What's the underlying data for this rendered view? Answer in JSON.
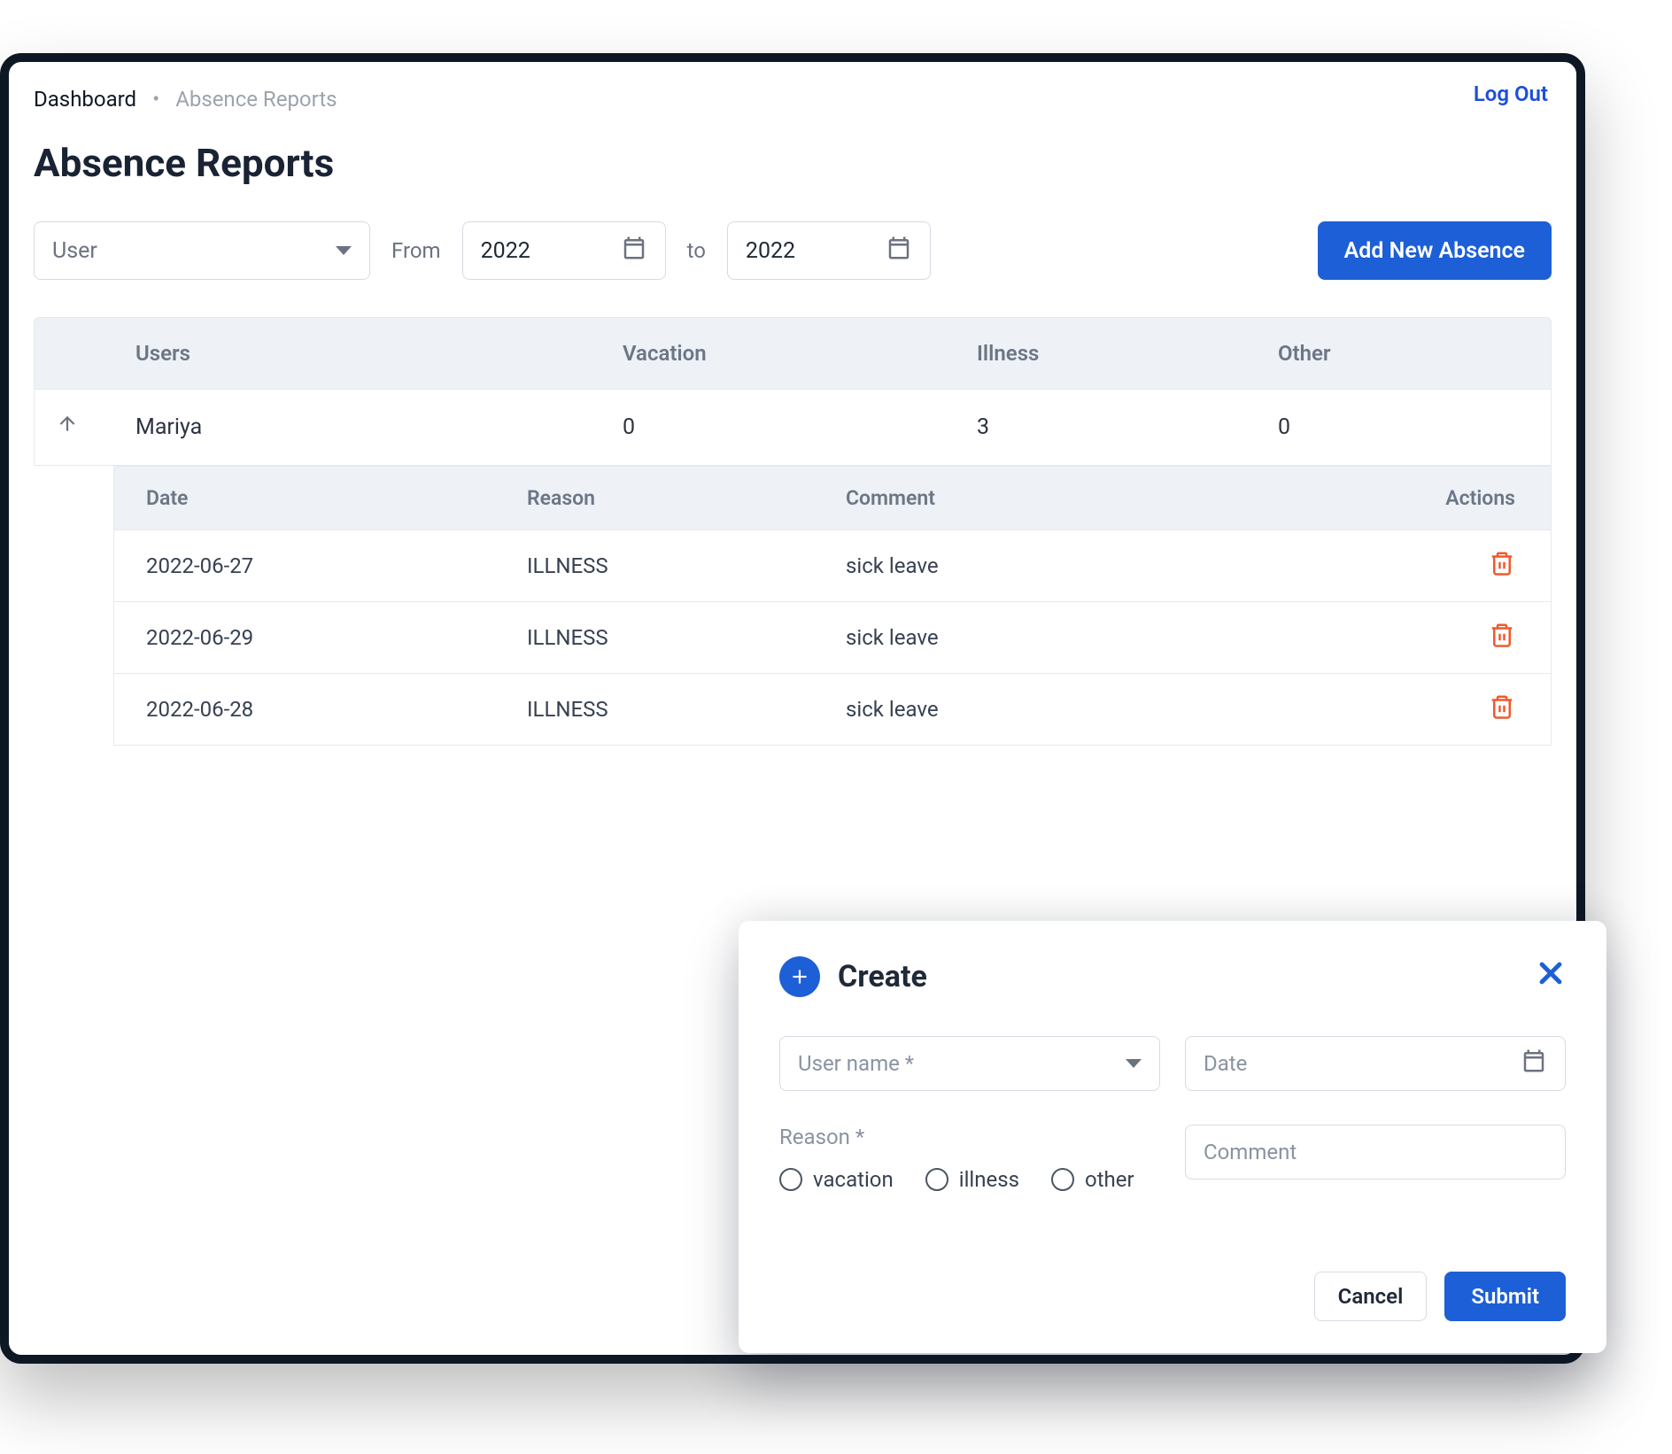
{
  "header": {
    "breadcrumb": [
      "Dashboard",
      "Absence Reports"
    ],
    "logout": "Log Out",
    "title": "Absence Reports"
  },
  "filters": {
    "user_placeholder": "User",
    "from_label": "From",
    "from_value": "2022",
    "to_label": "to",
    "to_value": "2022",
    "add_button": "Add New Absence"
  },
  "summary_table": {
    "columns": [
      "Users",
      "Vacation",
      "Illness",
      "Other"
    ],
    "rows": [
      {
        "user": "Mariya",
        "vacation": "0",
        "illness": "3",
        "other": "0"
      }
    ]
  },
  "detail_table": {
    "columns": [
      "Date",
      "Reason",
      "Comment",
      "Actions"
    ],
    "rows": [
      {
        "date": "2022-06-27",
        "reason": "ILLNESS",
        "comment": "sick leave"
      },
      {
        "date": "2022-06-29",
        "reason": "ILLNESS",
        "comment": "sick leave"
      },
      {
        "date": "2022-06-28",
        "reason": "ILLNESS",
        "comment": "sick leave"
      }
    ]
  },
  "modal": {
    "title": "Create",
    "user_placeholder": "User name *",
    "date_placeholder": "Date",
    "reason_label": "Reason *",
    "reason_options": [
      "vacation",
      "illness",
      "other"
    ],
    "comment_placeholder": "Comment",
    "cancel": "Cancel",
    "submit": "Submit"
  }
}
